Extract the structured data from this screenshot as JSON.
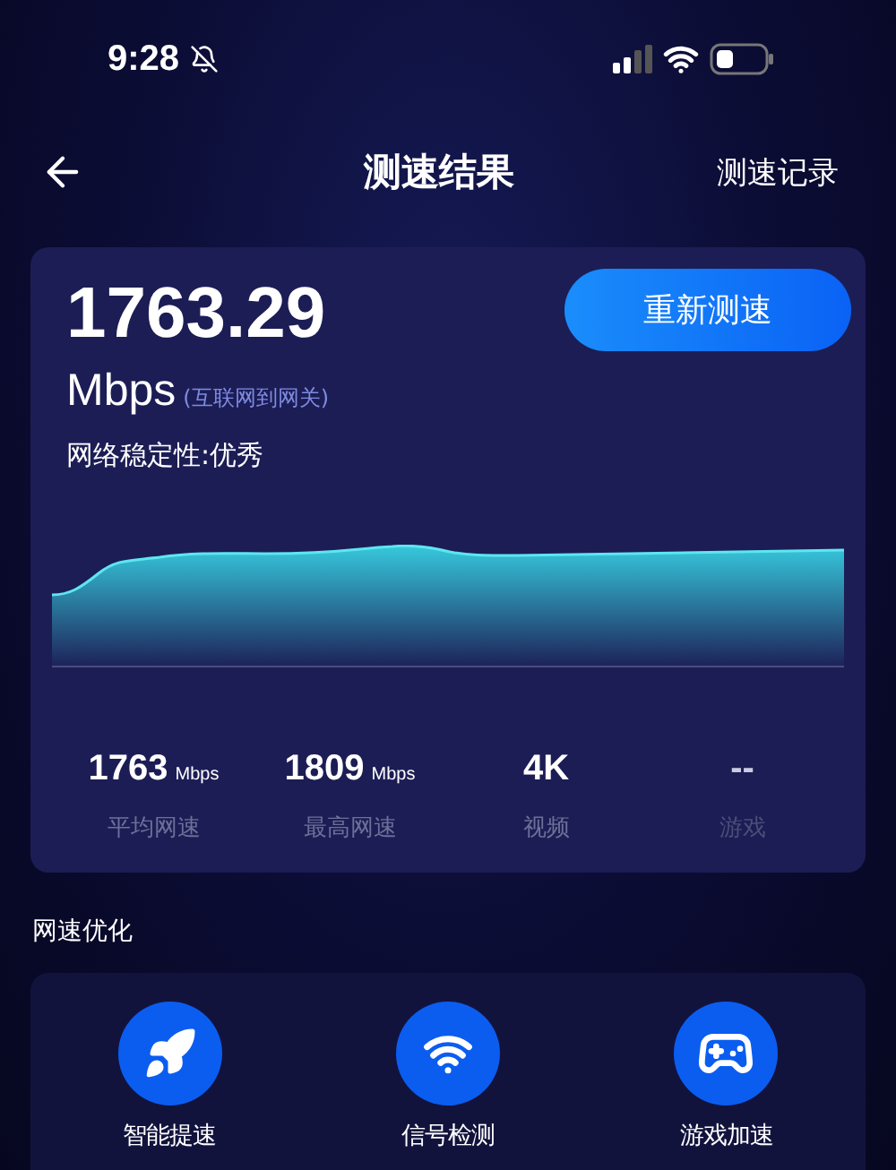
{
  "status_bar": {
    "time": "9:28"
  },
  "header": {
    "title": "测速结果",
    "action": "测速记录"
  },
  "result": {
    "speed": "1763.29",
    "unit": "Mbps",
    "scope": "(互联网到网关)",
    "stability": "网络稳定性:优秀",
    "button": "重新测速"
  },
  "stats": [
    {
      "value": "1763",
      "unit": "Mbps",
      "label": "平均网速",
      "muted": false
    },
    {
      "value": "1809",
      "unit": "Mbps",
      "label": "最高网速",
      "muted": false
    },
    {
      "value": "4K",
      "label": "视频",
      "muted": false
    },
    {
      "value": "--",
      "label": "游戏",
      "muted": true
    }
  ],
  "section_title": "网速优化",
  "tools": [
    {
      "kind": "rocket",
      "label": "智能提速"
    },
    {
      "kind": "wifi",
      "label": "信号检测"
    },
    {
      "kind": "gamepad",
      "label": "游戏加速"
    }
  ]
}
